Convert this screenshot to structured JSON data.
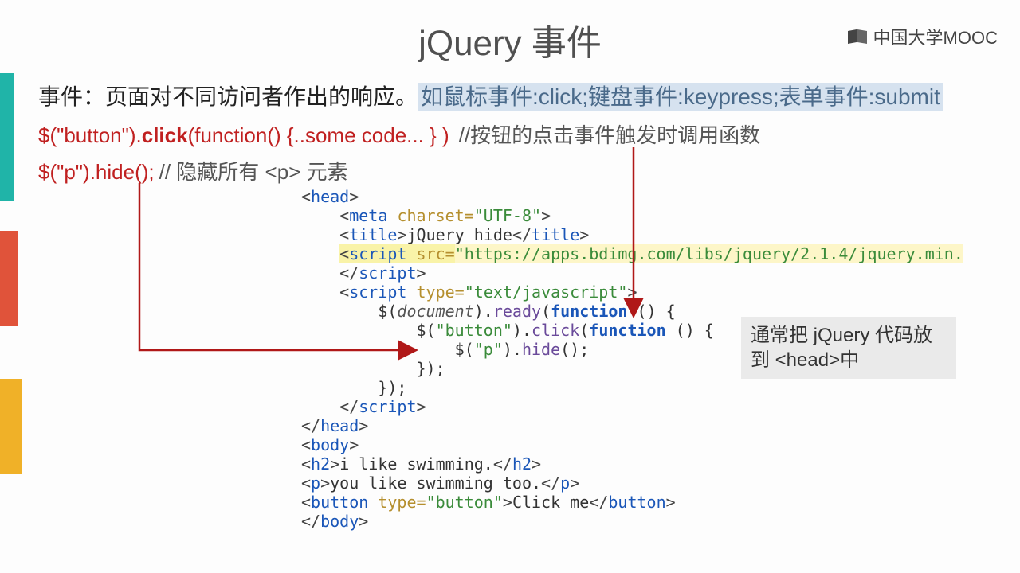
{
  "slide": {
    "title": "jQuery 事件",
    "logo": "中国大学MOOC"
  },
  "text": {
    "line1_a": "事件：页面对不同访问者作出的响应。",
    "line1_b": "如鼠标事件:click;键盘事件:keypress;表单事件:submit",
    "line2_a": "$(\"button\").",
    "line2_b": "click",
    "line2_c": "(function() {..some code... } )",
    "line2_cmt": "//按钮的点击事件触发时调用函数",
    "line3_a": "$(\"p\").hide();",
    "line3_cmt": "// 隐藏所有 <p> 元素",
    "sidebox": "通常把 jQuery 代码放到 <head>中"
  },
  "code": {
    "meta_attr": "charset=",
    "meta_val": "\"UTF-8\"",
    "title_text": "jQuery hide",
    "script_src_attr": "src=",
    "script_src_val": "\"https://apps.bdimg.com/libs/jquery/2.1.4/jquery.min.",
    "script_type_attr": "type=",
    "script_type_val": "\"text/javascript\"",
    "js_ready_a": "$(",
    "js_ready_b": "document",
    "js_ready_c": ").",
    "js_ready_d": "ready",
    "js_ready_e": "(",
    "js_ready_f": "function",
    "js_ready_g": " () {",
    "js_click_a": "$(",
    "js_click_b": "\"button\"",
    "js_click_c": ").",
    "js_click_d": "click",
    "js_click_e": "(",
    "js_click_f": "function",
    "js_click_g": " () {",
    "js_hide_a": "$(",
    "js_hide_b": "\"p\"",
    "js_hide_c": ").",
    "js_hide_d": "hide",
    "js_hide_e": "();",
    "js_close1": "});",
    "js_close2": "});",
    "h2_text": "i like swimming.",
    "p_text": "you like swimming too.",
    "btn_attr": "type=",
    "btn_val": "\"button\"",
    "btn_text": "Click me"
  }
}
